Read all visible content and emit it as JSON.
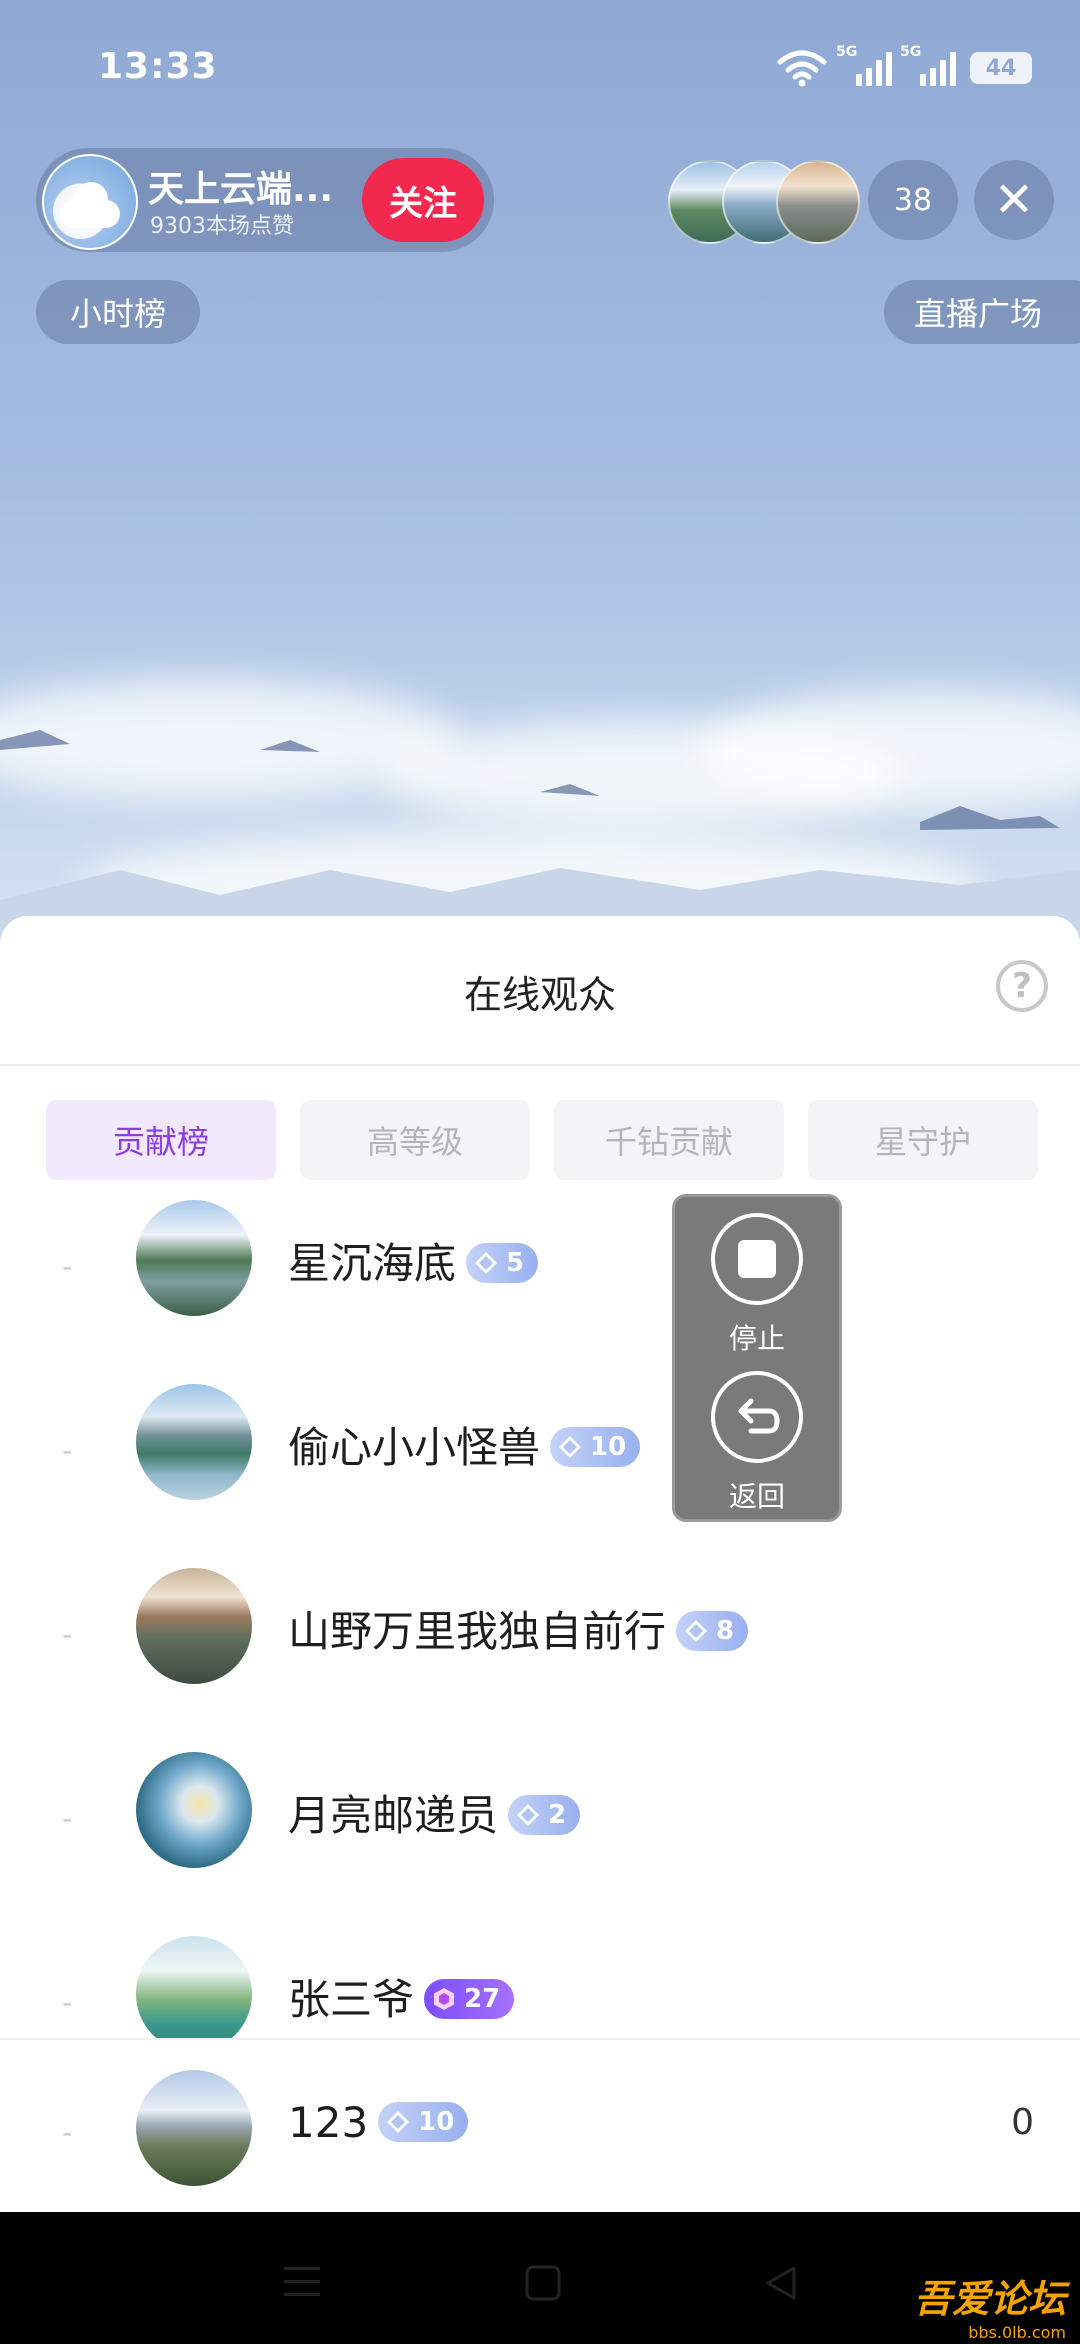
{
  "status_bar": {
    "time": "13:33",
    "net1": "5G",
    "net2": "5G",
    "battery": "44"
  },
  "host": {
    "name": "天上云端...",
    "likes": "9303本场点赞",
    "follow_label": "关注"
  },
  "viewer_count": "38",
  "close_symbol": "✕",
  "pills": {
    "hour_rank": "小时榜",
    "live_plaza": "直播广场"
  },
  "sheet": {
    "title": "在线观众",
    "help_symbol": "?",
    "tabs": [
      {
        "label": "贡献榜",
        "active": true
      },
      {
        "label": "高等级",
        "active": false
      },
      {
        "label": "千钻贡献",
        "active": false
      },
      {
        "label": "星守护",
        "active": false
      }
    ],
    "rows": [
      {
        "rank": "-",
        "name": "星沉海底",
        "level": "5",
        "badge": "blue"
      },
      {
        "rank": "-",
        "name": "偷心小小怪兽",
        "level": "10",
        "badge": "blue"
      },
      {
        "rank": "-",
        "name": "山野万里我独自前行",
        "level": "8",
        "badge": "blue"
      },
      {
        "rank": "-",
        "name": "月亮邮递员",
        "level": "2",
        "badge": "blue"
      },
      {
        "rank": "-",
        "name": "张三爷",
        "level": "27",
        "badge": "purple"
      }
    ],
    "me": {
      "rank": "-",
      "name": "123",
      "level": "10",
      "score": "0"
    }
  },
  "recorder": {
    "stop_label": "停止",
    "back_label": "返回"
  },
  "watermark": {
    "title": "吾爱论坛",
    "url": "bbs.0lb.com"
  },
  "colors": {
    "accent": "#8a3ee0",
    "follow": "#f2284f"
  }
}
